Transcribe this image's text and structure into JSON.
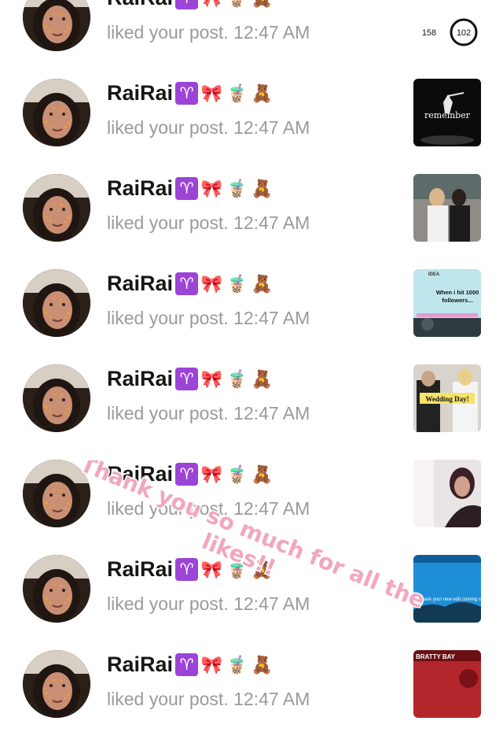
{
  "notifications": [
    {
      "username": "RaiRai",
      "emojis": [
        "aries-sign",
        "ribbon-bow",
        "bubble-tea",
        "teddy-bear"
      ],
      "action": "liked your post.",
      "time": "12:47 AM",
      "thumb": {
        "kind": "stats",
        "num1": "158",
        "num2": "102"
      }
    },
    {
      "username": "RaiRai",
      "emojis": [
        "aries-sign",
        "ribbon-bow",
        "bubble-tea",
        "teddy-bear"
      ],
      "action": "liked your post.",
      "time": "12:47 AM",
      "thumb": {
        "kind": "dancer",
        "text": "remember"
      }
    },
    {
      "username": "RaiRai",
      "emojis": [
        "aries-sign",
        "ribbon-bow",
        "bubble-tea",
        "teddy-bear"
      ],
      "action": "liked your post.",
      "time": "12:47 AM",
      "thumb": {
        "kind": "couple"
      }
    },
    {
      "username": "RaiRai",
      "emojis": [
        "aries-sign",
        "ribbon-bow",
        "bubble-tea",
        "teddy-bear"
      ],
      "action": "liked your post.",
      "time": "12:47 AM",
      "thumb": {
        "kind": "idea",
        "top": "IDEA",
        "line1": "When i hit 1000",
        "line2": "followers..."
      }
    },
    {
      "username": "RaiRai",
      "emojis": [
        "aries-sign",
        "ribbon-bow",
        "bubble-tea",
        "teddy-bear"
      ],
      "action": "liked your post.",
      "time": "12:47 AM",
      "thumb": {
        "kind": "wedding",
        "text": "Wedding Day!"
      }
    },
    {
      "username": "RaiRai",
      "emojis": [
        "aries-sign",
        "ribbon-bow",
        "bubble-tea",
        "teddy-bear"
      ],
      "action": "liked your post.",
      "time": "12:47 AM",
      "thumb": {
        "kind": "portrait"
      }
    },
    {
      "username": "RaiRai",
      "emojis": [
        "aries-sign",
        "ribbon-bow",
        "bubble-tea",
        "teddy-bear"
      ],
      "action": "liked your post.",
      "time": "12:47 AM",
      "thumb": {
        "kind": "sky",
        "text": "Thank you! new edit coming soon!"
      }
    },
    {
      "username": "RaiRai",
      "emojis": [
        "aries-sign",
        "ribbon-bow",
        "bubble-tea",
        "teddy-bear"
      ],
      "action": "liked your post.",
      "time": "12:47 AM",
      "thumb": {
        "kind": "red",
        "text": "BRATTY BAY"
      }
    }
  ],
  "overlay": {
    "line1": "Thank you so much for all the",
    "line2": "likes!!"
  },
  "colors": {
    "username": "#161616",
    "subtext": "#9a9a9a",
    "overlay_pink": "#f2a6bf",
    "aries_purple": "#9b44d6"
  }
}
